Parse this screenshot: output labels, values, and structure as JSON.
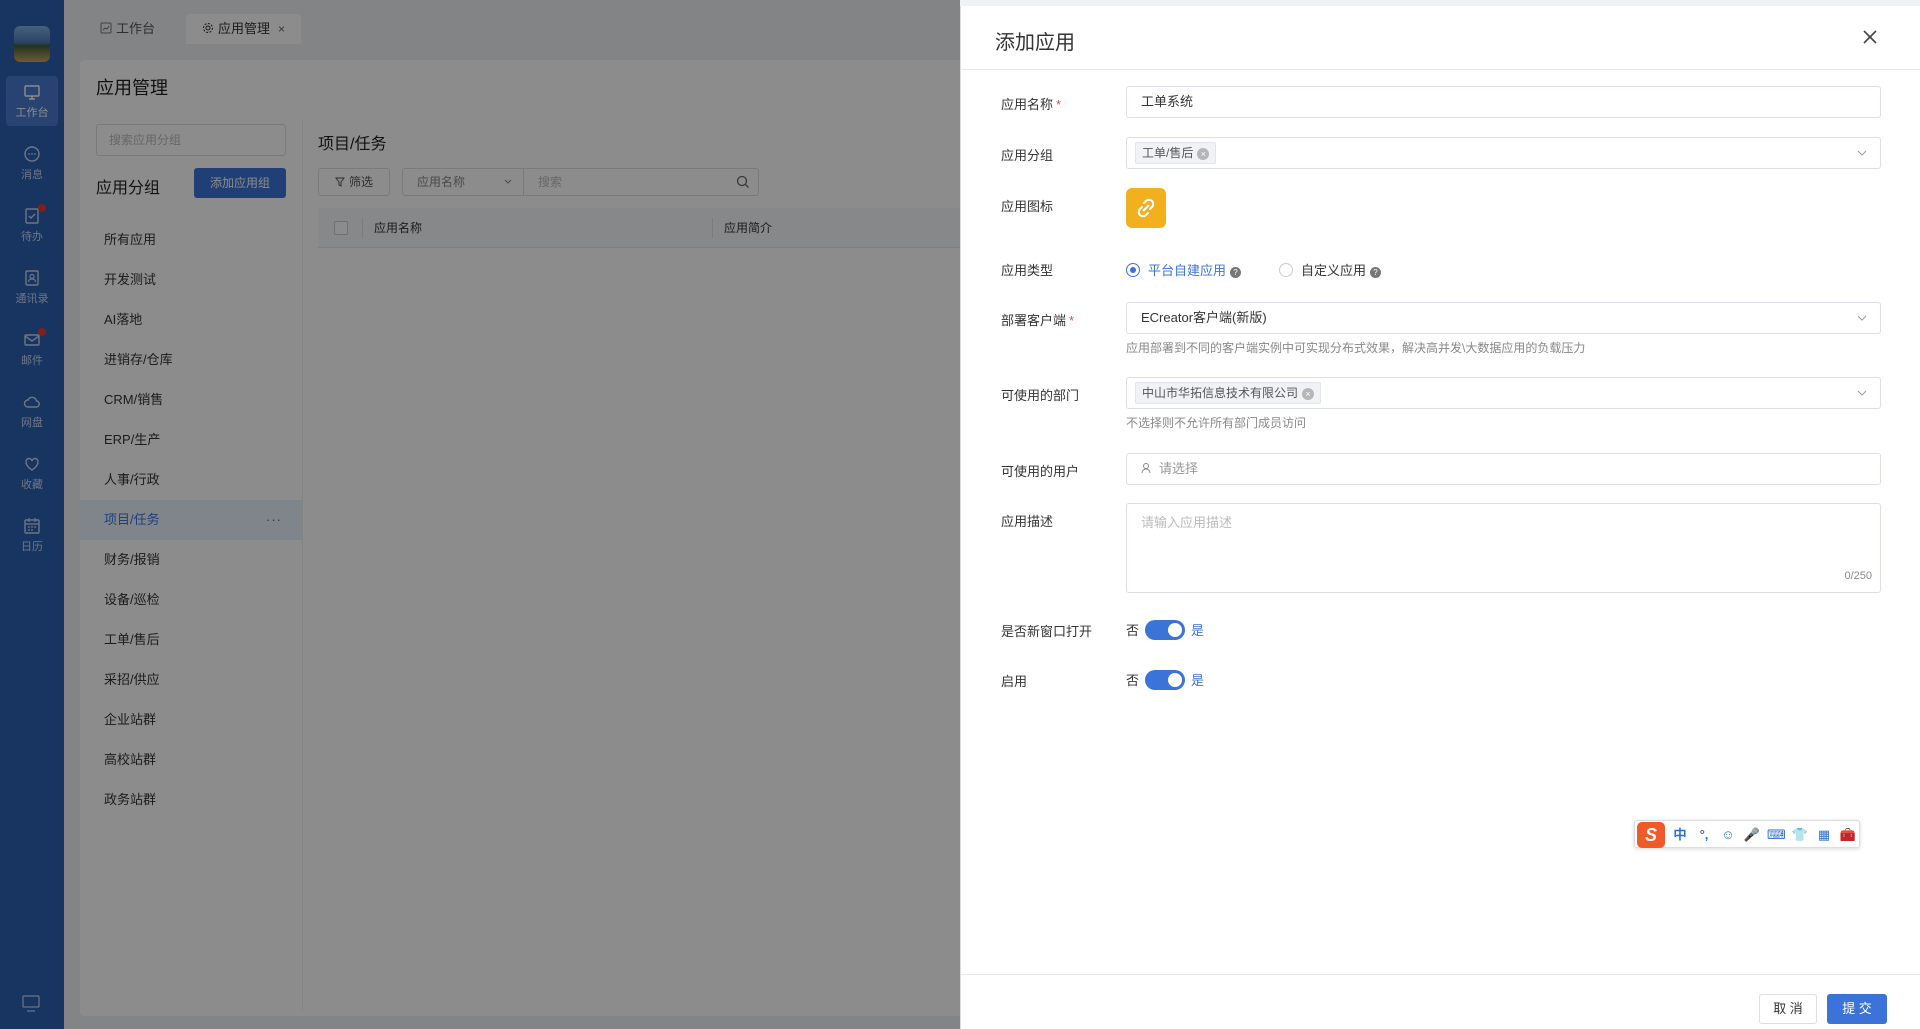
{
  "rail": {
    "items": [
      {
        "label": "工作台",
        "icon": "monitor-icon",
        "active": true,
        "dot": false
      },
      {
        "label": "消息",
        "icon": "chat-icon",
        "active": false,
        "dot": false
      },
      {
        "label": "待办",
        "icon": "todo-icon",
        "active": false,
        "dot": true
      },
      {
        "label": "通讯录",
        "icon": "contacts-icon",
        "active": false,
        "dot": false
      },
      {
        "label": "邮件",
        "icon": "mail-icon",
        "active": false,
        "dot": true
      },
      {
        "label": "网盘",
        "icon": "cloud-icon",
        "active": false,
        "dot": false
      },
      {
        "label": "收藏",
        "icon": "heart-icon",
        "active": false,
        "dot": false
      },
      {
        "label": "日历",
        "icon": "calendar-icon",
        "active": false,
        "dot": false
      }
    ]
  },
  "tabs": [
    {
      "label": "工作台",
      "icon": "chart-icon"
    },
    {
      "label": "应用管理",
      "icon": "gear-icon",
      "close": "×"
    }
  ],
  "main": {
    "title": "应用管理",
    "group_search_placeholder": "搜索应用分组",
    "group_title": "应用分组",
    "add_group_label": "添加应用组",
    "groups": [
      "所有应用",
      "开发测试",
      "AI落地",
      "进销存/仓库",
      "CRM/销售",
      "ERP/生产",
      "人事/行政",
      "项目/任务",
      "财务/报销",
      "设备/巡检",
      "工单/售后",
      "采招/供应",
      "企业站群",
      "高校站群",
      "政务站群"
    ],
    "active_group": "项目/任务",
    "more": "···",
    "right_title": "项目/任务",
    "filter_label": "筛选",
    "field_select": "应用名称",
    "search_placeholder": "搜索",
    "columns": [
      "应用名称",
      "应用简介"
    ]
  },
  "drawer": {
    "title": "添加应用",
    "fields": {
      "name": {
        "label": "应用名称",
        "required": "*",
        "value": "工单系统"
      },
      "group": {
        "label": "应用分组",
        "tag": "工单/售后"
      },
      "icon": {
        "label": "应用图标",
        "icon": "link-icon",
        "color": "#f2b01e"
      },
      "type": {
        "label": "应用类型",
        "options": [
          "平台自建应用",
          "自定义应用"
        ],
        "selected": "平台自建应用",
        "help": "?"
      },
      "client": {
        "label": "部署客户端",
        "required": "*",
        "value": "ECreator客户端(新版)",
        "hint": "应用部署到不同的客户端实例中可实现分布式效果，解决高并发\\大数据应用的负载压力"
      },
      "dept": {
        "label": "可使用的部门",
        "tag": "中山市华拓信息技术有限公司",
        "hint": "不选择则不允许所有部门成员访问"
      },
      "users": {
        "label": "可使用的用户",
        "placeholder": "请选择"
      },
      "desc": {
        "label": "应用描述",
        "placeholder": "请输入应用描述",
        "counter": "0/250"
      },
      "new_window": {
        "label": "是否新窗口打开",
        "off": "否",
        "on": "是",
        "value": true
      },
      "enabled": {
        "label": "启用",
        "off": "否",
        "on": "是",
        "value": true
      }
    },
    "cancel_label": "取 消",
    "submit_label": "提 交"
  },
  "ime": {
    "logo": "S",
    "items": [
      "中",
      "°,",
      "☺",
      "🎤",
      "⌨",
      "👕",
      "▦",
      "🧰"
    ]
  },
  "colors": {
    "primary": "#3c73d9",
    "rail": "#2d5fb0",
    "annotation": "#e53935"
  }
}
